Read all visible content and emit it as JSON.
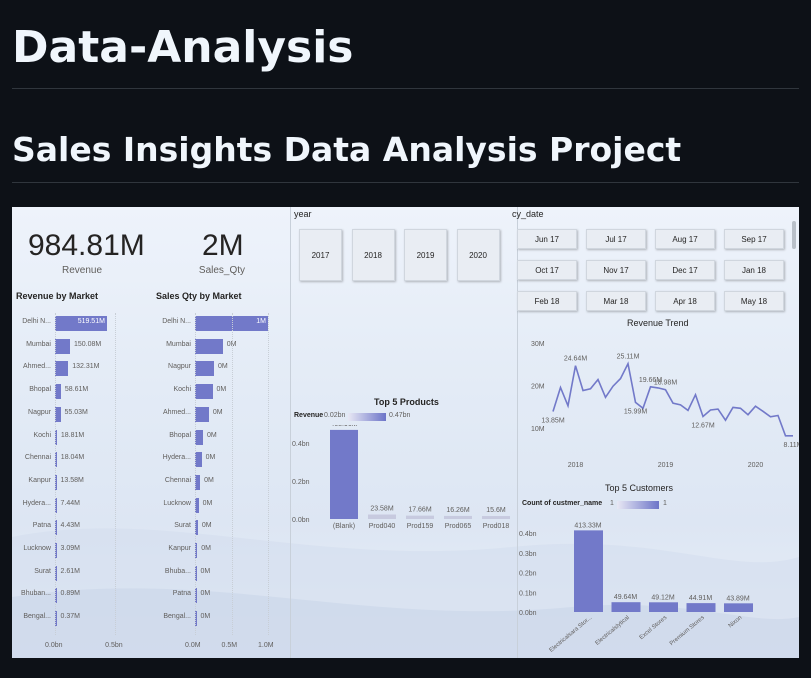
{
  "page": {
    "title": "Data-Analysis",
    "subtitle": "Sales Insights Data Analysis Project"
  },
  "cards": {
    "revenue_value": "984.81M",
    "revenue_label": "Revenue",
    "qty_value": "2M",
    "qty_label": "Sales_Qty"
  },
  "slicers": {
    "year_title": "year",
    "years": [
      "2017",
      "2018",
      "2019",
      "2020"
    ],
    "date_title": "cy_date",
    "dates": [
      "Jun 17",
      "Jul 17",
      "Aug 17",
      "Sep 17",
      "Oct 17",
      "Nov 17",
      "Dec 17",
      "Jan 18",
      "Feb 18",
      "Mar 18",
      "Apr 18",
      "May 18"
    ]
  },
  "colors": {
    "bar": "#7279c9",
    "bar_light": "#c7cadf",
    "line": "#7279c9"
  },
  "chart_data": [
    {
      "type": "bar",
      "orientation": "horizontal",
      "title": "Revenue by Market",
      "categories": [
        "Delhi N...",
        "Mumbai",
        "Ahmed...",
        "Bhopal",
        "Nagpur",
        "Kochi",
        "Chennai",
        "Kanpur",
        "Hydera...",
        "Patna",
        "Lucknow",
        "Surat",
        "Bhuban...",
        "Bengal..."
      ],
      "values": [
        519.51,
        150.08,
        132.31,
        58.61,
        55.03,
        18.81,
        18.04,
        13.58,
        7.44,
        4.43,
        3.09,
        2.61,
        0.89,
        0.37
      ],
      "labels": [
        "519.51M",
        "150.08M",
        "132.31M",
        "58.61M",
        "55.03M",
        "18.81M",
        "18.04M",
        "13.58M",
        "7.44M",
        "4.43M",
        "3.09M",
        "2.61M",
        "0.89M",
        "0.37M"
      ],
      "unit": "M",
      "xticks": [
        "0.0bn",
        "0.5bn"
      ],
      "xlim": [
        0,
        620
      ]
    },
    {
      "type": "bar",
      "orientation": "horizontal",
      "title": "Sales Qty by Market",
      "categories": [
        "Delhi N...",
        "Mumbai",
        "Nagpur",
        "Kochi",
        "Ahmed...",
        "Bhopal",
        "Hydera...",
        "Chennai",
        "Lucknow",
        "Surat",
        "Kanpur",
        "Bhuba...",
        "Patna",
        "Bengal..."
      ],
      "values": [
        1.0,
        0.38,
        0.26,
        0.24,
        0.19,
        0.11,
        0.09,
        0.07,
        0.05,
        0.04,
        0.03,
        0.02,
        0.02,
        0.01
      ],
      "labels": [
        "1M",
        "0M",
        "0M",
        "0M",
        "0M",
        "0M",
        "0M",
        "0M",
        "0M",
        "0M",
        "0M",
        "0M",
        "0M",
        "0M"
      ],
      "xticks": [
        "0.0M",
        "0.5M",
        "1.0M"
      ],
      "xlim": [
        0,
        1.0
      ]
    },
    {
      "type": "bar",
      "title": "Top 5 Products",
      "legend_title": "Revenue",
      "legend_min": "0.02bn",
      "legend_max": "0.47bn",
      "categories": [
        "(Blank)",
        "Prod040",
        "Prod159",
        "Prod065",
        "Prod018"
      ],
      "values": [
        0.46896,
        0.02358,
        0.01766,
        0.01626,
        0.0156
      ],
      "labels": [
        "468.96M",
        "23.58M",
        "17.66M",
        "16.26M",
        "15.6M"
      ],
      "yticks": [
        "0.4bn",
        "0.2bn",
        "0.0bn"
      ],
      "ylim": [
        0,
        0.5
      ]
    },
    {
      "type": "line",
      "title": "Revenue Trend",
      "x": [
        "2017-10",
        "2017-11",
        "2017-12",
        "2018-01",
        "2018-02",
        "2018-03",
        "2018-04",
        "2018-05",
        "2018-06",
        "2018-07",
        "2018-08",
        "2018-09",
        "2018-10",
        "2018-11",
        "2018-12",
        "2019-01",
        "2019-02",
        "2019-03",
        "2019-04",
        "2019-05",
        "2019-06",
        "2019-07",
        "2019-08",
        "2019-09",
        "2019-10",
        "2019-11",
        "2019-12",
        "2020-01",
        "2020-02",
        "2020-03",
        "2020-04",
        "2020-05",
        "2020-06"
      ],
      "y": [
        13.85,
        19.5,
        15.2,
        24.64,
        18.8,
        19.2,
        21.4,
        17.2,
        19.8,
        21.6,
        25.11,
        15.99,
        14.6,
        19.66,
        19.4,
        18.98,
        15.8,
        15.4,
        14.1,
        17.8,
        12.67,
        14.2,
        14.4,
        11.8,
        14.8,
        14.6,
        13.1,
        15.1,
        13.9,
        12.6,
        12.9,
        8.11,
        8.11
      ],
      "annotations": [
        {
          "x": "2017-10",
          "label": "13.85M"
        },
        {
          "x": "2018-01",
          "label": "24.64M"
        },
        {
          "x": "2018-08",
          "label": "25.11M"
        },
        {
          "x": "2018-09",
          "label": "15.99M"
        },
        {
          "x": "2018-11",
          "label": "19.66M"
        },
        {
          "x": "2019-01",
          "label": "18.98M"
        },
        {
          "x": "2019-06",
          "label": "12.67M"
        },
        {
          "x": "2020-06",
          "label": "8.11M"
        }
      ],
      "yticks": [
        "30M",
        "20M",
        "10M"
      ],
      "xticks": [
        "2018",
        "2019",
        "2020"
      ],
      "ylim": [
        5,
        30
      ]
    },
    {
      "type": "bar",
      "title": "Top 5 Customers",
      "legend_title": "Count of custmer_name",
      "legend_min": "1",
      "legend_max": "1",
      "categories": [
        "Electricalsara Stor...",
        "Electricalslytical",
        "Excel Stores",
        "Premium Stores",
        "Nixon"
      ],
      "values": [
        0.41333,
        0.04964,
        0.04912,
        0.04491,
        0.04389
      ],
      "labels": [
        "413.33M",
        "49.64M",
        "49.12M",
        "44.91M",
        "43.89M"
      ],
      "yticks": [
        "0.4bn",
        "0.3bn",
        "0.2bn",
        "0.1bn",
        "0.0bn"
      ],
      "ylim": [
        0,
        0.4
      ]
    }
  ]
}
